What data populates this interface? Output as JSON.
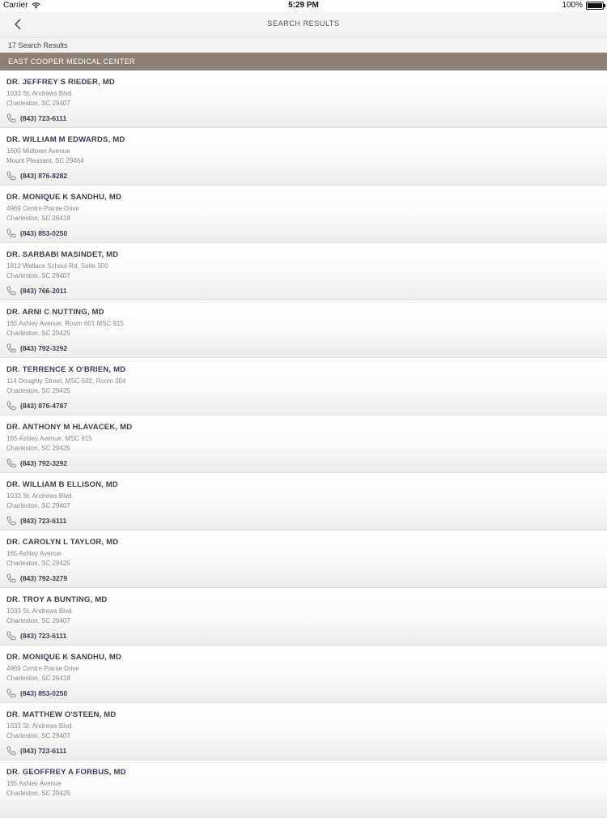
{
  "status": {
    "carrier": "Carrier",
    "time": "5:29 PM",
    "battery": "100%",
    "battery_level": 1.0
  },
  "nav": {
    "title": "SEARCH RESULTS"
  },
  "results": {
    "count_label": "17 Search Results"
  },
  "section": {
    "title": "EAST COOPER MEDICAL CENTER"
  },
  "doctors": [
    {
      "name": "DR. JEFFREY S RIEDER, MD",
      "address1": "1033 St. Andrews Blvd.",
      "address2": "Charleston, SC 29407",
      "phone": "(843) 723-6111"
    },
    {
      "name": "DR. WILLIAM M EDWARDS, MD",
      "address1": "1600 Midtown Avenue",
      "address2": "Mount Pleasant, SC 29464",
      "phone": "(843) 876-8282"
    },
    {
      "name": "DR. MONIQUE K SANDHU, MD",
      "address1": "4969 Centre Pointe Drive",
      "address2": "Charleston, SC 29418",
      "phone": "(843) 853-0250"
    },
    {
      "name": "DR. SARBABI MASINDET, MD",
      "address1": "1812 Wallace School Rd, Suite 300",
      "address2": "Charleston, SC 29407",
      "phone": "(843) 766-2011"
    },
    {
      "name": "DR. ARNI C NUTTING, MD",
      "address1": "165 Ashley Avenue, Room 601  MSC 915",
      "address2": "Charleston, SC 29425",
      "phone": "(843) 792-3292"
    },
    {
      "name": "DR. TERRENCE X O'BRIEN, MD",
      "address1": "114 Doughty Street, MSC 592, Room 304",
      "address2": "Charleston, SC 29425",
      "phone": "(843) 876-4787"
    },
    {
      "name": "DR. ANTHONY M HLAVACEK, MD",
      "address1": "165 Ashley Avenue, MSC 915",
      "address2": "Charleston, SC 29425",
      "phone": "(843) 792-3292"
    },
    {
      "name": "DR. WILLIAM B ELLISON, MD",
      "address1": "1033 St. Andrews Blvd.",
      "address2": "Charleston, SC 29407",
      "phone": "(843) 723-6111"
    },
    {
      "name": "DR. CAROLYN L TAYLOR, MD",
      "address1": "165 Ashley Avenue",
      "address2": "Charleston, SC 29425",
      "phone": "(843) 792-3279"
    },
    {
      "name": "DR. TROY A BUNTING, MD",
      "address1": "1033 St. Andrews Blvd.",
      "address2": "Charleston, SC 29407",
      "phone": "(843) 723-6111"
    },
    {
      "name": "DR. MONIQUE K SANDHU, MD",
      "address1": "4969 Centre Pointe Drive",
      "address2": "Charleston, SC 29418",
      "phone": "(843) 853-0250"
    },
    {
      "name": "DR. MATTHEW O'STEEN, MD",
      "address1": "1033 St. Andrews Blvd.",
      "address2": "Charleston, SC 29407",
      "phone": "(843) 723-6111"
    },
    {
      "name": "DR. GEOFFREY A FORBUS, MD",
      "address1": "165 Ashley Avenue",
      "address2": "Charleston, SC 29425",
      "phone": ""
    }
  ]
}
